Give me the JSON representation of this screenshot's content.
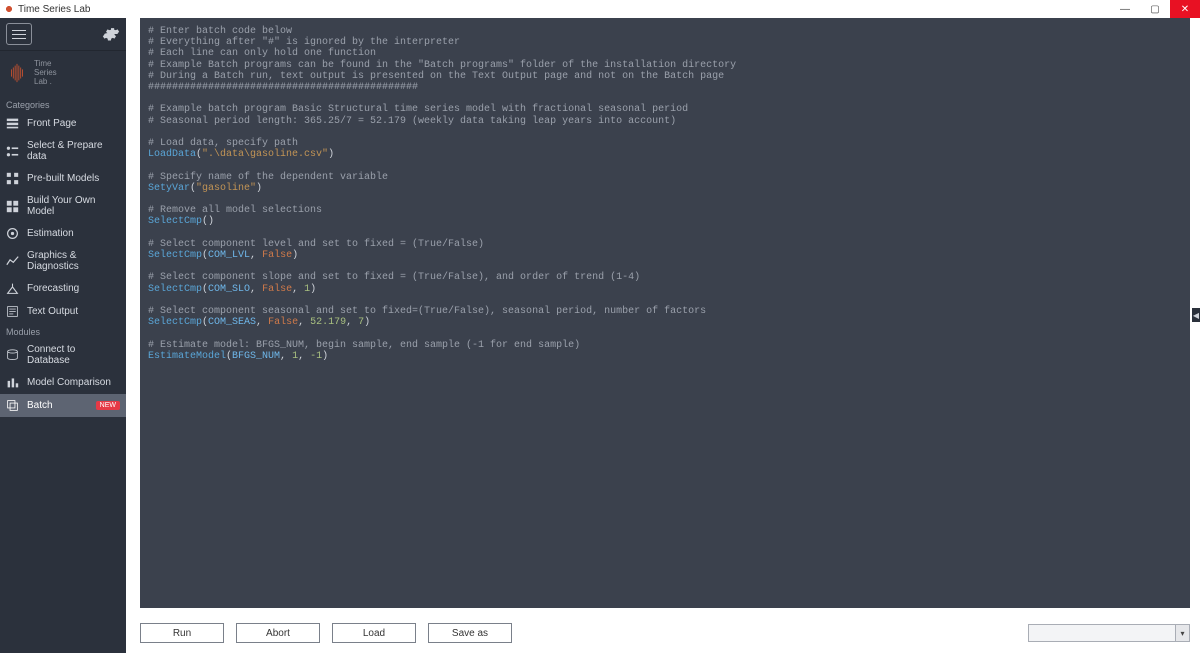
{
  "window": {
    "title": "Time Series Lab"
  },
  "brand": {
    "line1": "Time",
    "line2": "Series",
    "line3": "Lab ."
  },
  "sections": {
    "categories_label": "Categories",
    "modules_label": "Modules"
  },
  "nav_categories": [
    {
      "id": "front-page",
      "label": "Front Page"
    },
    {
      "id": "select-prepare",
      "label": "Select & Prepare data"
    },
    {
      "id": "prebuilt-models",
      "label": "Pre-built Models"
    },
    {
      "id": "build-own",
      "label": "Build Your Own Model"
    },
    {
      "id": "estimation",
      "label": "Estimation"
    },
    {
      "id": "graphics",
      "label": "Graphics & Diagnostics"
    },
    {
      "id": "forecasting",
      "label": "Forecasting"
    },
    {
      "id": "text-output",
      "label": "Text Output"
    }
  ],
  "nav_modules": [
    {
      "id": "connect-db",
      "label": "Connect to Database"
    },
    {
      "id": "model-compare",
      "label": "Model Comparison"
    },
    {
      "id": "batch",
      "label": "Batch",
      "badge": "NEW",
      "active": true
    }
  ],
  "buttons": {
    "run": "Run",
    "abort": "Abort",
    "load": "Load",
    "saveas": "Save as"
  },
  "combo": {
    "value": ""
  },
  "code": {
    "c1": "# Enter batch code below",
    "c2": "# Everything after \"#\" is ignored by the interpreter",
    "c3": "# Each line can only hold one function",
    "c4": "# Example Batch programs can be found in the \"Batch programs\" folder of the installation directory",
    "c5": "# During a Batch run, text output is presented on the Text Output page and not on the Batch page",
    "c6": "#############################################",
    "c7": "# Example batch program Basic Structural time series model with fractional seasonal period",
    "c8": "# Seasonal period length: 365.25/7 = 52.179 (weekly data taking leap years into account)",
    "c9": "# Load data, specify path",
    "fn_loaddata": "LoadData",
    "str_path": "\".\\data\\gasoline.csv\"",
    "c10": "# Specify name of the dependent variable",
    "fn_setyvar": "SetyVar",
    "str_gas": "\"gasoline\"",
    "c11": "# Remove all model selections",
    "fn_selectcmp": "SelectCmp",
    "c12": "# Select component level and set to fixed = (True/False)",
    "con_lvl": "COM_LVL",
    "kw_false": "False",
    "c13": "# Select component slope and set to fixed = (True/False), and order of trend (1-4)",
    "con_slo": "COM_SLO",
    "num_1": "1",
    "c14": "# Select component seasonal and set to fixed=(True/False), seasonal period, number of factors",
    "con_seas": "COM_SEAS",
    "num_52": "52.179",
    "num_7": "7",
    "c15": "# Estimate model: BFGS_NUM, begin sample, end sample (-1 for end sample)",
    "fn_est": "EstimateModel",
    "con_bfgs": "BFGS_NUM",
    "num_m1": "-1",
    "paren_open": "(",
    "paren_close": ")",
    "comma": ", "
  }
}
